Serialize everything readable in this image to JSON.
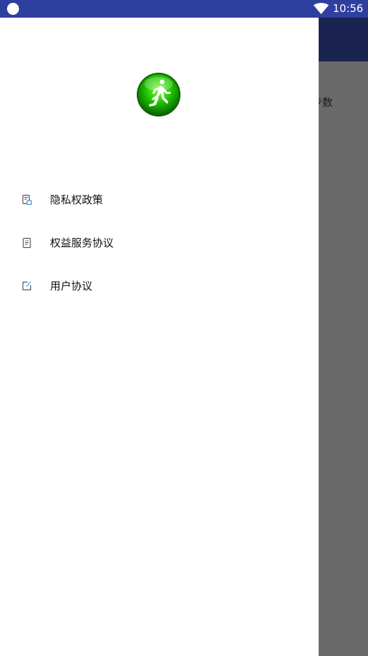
{
  "status_bar": {
    "time": "10:56",
    "icons": [
      "circle-icon",
      "wifi-icon"
    ]
  },
  "background_screen": {
    "steps_label": "步数"
  },
  "drawer": {
    "logo": "runner-logo",
    "menu": [
      {
        "label": "隐私权政策",
        "icon": "privacy-document-icon"
      },
      {
        "label": "权益服务协议",
        "icon": "document-icon"
      },
      {
        "label": "用户协议",
        "icon": "edit-document-icon"
      }
    ]
  },
  "colors": {
    "status_bar": "#2e3f9f",
    "app_bar": "#1b2451",
    "scrim": "#6a6a6a",
    "logo_green": "#16a800",
    "icon_gray": "#555555",
    "icon_accent": "#3f8fe0"
  }
}
